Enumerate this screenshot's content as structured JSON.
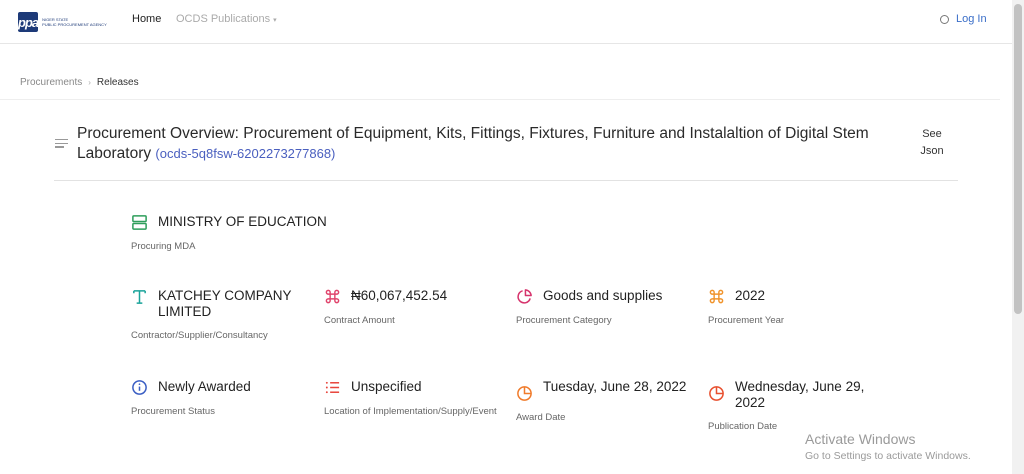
{
  "header": {
    "logo_mark": "ppa",
    "logo_text_line1": "NIGER STATE",
    "logo_text_line2": "PUBLIC PROCUREMENT AGENCY",
    "nav_home": "Home",
    "nav_ocds": "OCDS Publications",
    "login": "Log In"
  },
  "breadcrumb": {
    "item1": "Procurements",
    "separator": "›",
    "item2": "Releases"
  },
  "title": {
    "text": "Procurement Overview: Procurement of Equipment, Kits, Fittings, Fixtures, Furniture and Instalaltion of Digital Stem Laboratory",
    "ocid": "(ocds-5q8fsw-6202273277868)",
    "see_json": "See Json"
  },
  "details": {
    "mda": {
      "value": "MINISTRY OF EDUCATION",
      "label": "Procuring MDA",
      "icon": "server-icon",
      "color": "#2e9e5b"
    },
    "contractor": {
      "value": "KATCHEY COMPANY LIMITED",
      "label": "Contractor/Supplier/Consultancy",
      "icon": "text-icon",
      "color": "#1aa39a"
    },
    "amount": {
      "value": "₦60,067,452.54",
      "label": "Contract Amount",
      "icon": "command-icon",
      "color": "#e0436b"
    },
    "category": {
      "value": "Goods and supplies",
      "label": "Procurement Category",
      "icon": "pie-chart-icon",
      "color": "#d6336c"
    },
    "year": {
      "value": "2022",
      "label": "Procurement Year",
      "icon": "command-icon",
      "color": "#f0932b"
    },
    "status": {
      "value": "Newly Awarded",
      "label": "Procurement Status",
      "icon": "info-icon",
      "color": "#3b5fc4"
    },
    "location": {
      "value": "Unspecified",
      "label": "Location of Implementation/Supply/Event",
      "icon": "list-icon",
      "color": "#e8453c"
    },
    "award_date": {
      "value": "Tuesday, June 28, 2022",
      "label": "Award Date",
      "icon": "clock-pie-icon",
      "color": "#f07b2b"
    },
    "publication_date": {
      "value": "Wednesday, June 29, 2022",
      "label": "Publication Date",
      "icon": "clock-pie-icon",
      "color": "#e8502f"
    }
  },
  "watermark": {
    "line1": "Activate Windows",
    "line2": "Go to Settings to activate Windows."
  }
}
